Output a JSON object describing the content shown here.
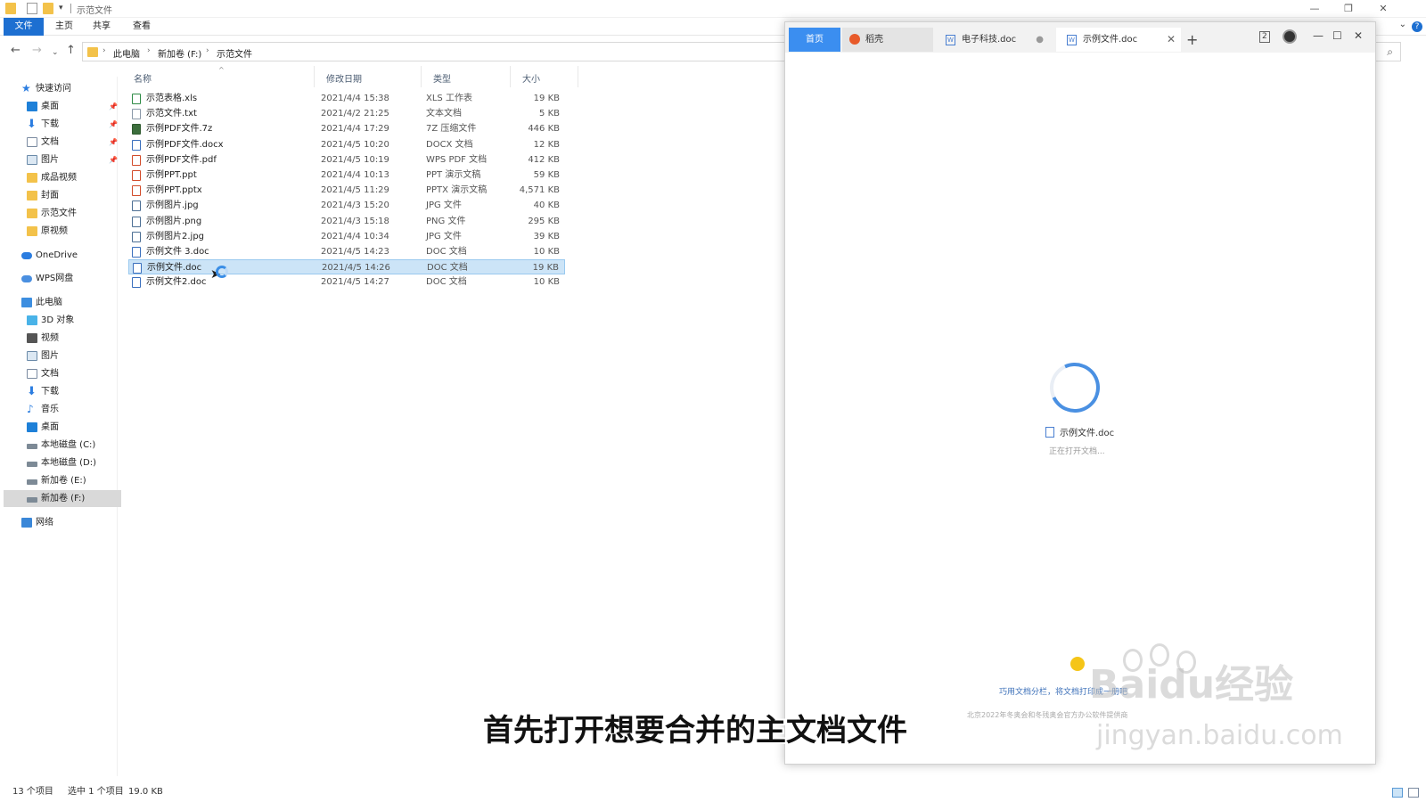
{
  "explorer": {
    "window_title": "示范文件",
    "ribbon_tabs": [
      "文件",
      "主页",
      "共享",
      "查看"
    ],
    "breadcrumb": [
      "此电脑",
      "新加卷 (F:)",
      "示范文件"
    ],
    "columns": {
      "name": "名称",
      "date": "修改日期",
      "type": "类型",
      "size": "大小"
    },
    "sidebar": {
      "quick_access": "快速访问",
      "items": [
        "桌面",
        "下载",
        "文档",
        "图片",
        "成品视频",
        "封面",
        "示范文件",
        "原视频"
      ],
      "onedrive": "OneDrive",
      "wps": "WPS网盘",
      "this_pc": "此电脑",
      "pc_items": [
        "3D 对象",
        "视频",
        "图片",
        "文档",
        "下载",
        "音乐",
        "桌面",
        "本地磁盘 (C:)",
        "本地磁盘 (D:)",
        "新加卷 (E:)",
        "新加卷 (F:)"
      ],
      "network": "网络"
    },
    "files": [
      {
        "name": "示范表格.xls",
        "date": "2021/4/4 15:38",
        "type": "XLS 工作表",
        "size": "19 KB",
        "icon": "xls"
      },
      {
        "name": "示范文件.txt",
        "date": "2021/4/2 21:25",
        "type": "文本文档",
        "size": "5 KB",
        "icon": "txt"
      },
      {
        "name": "示例PDF文件.7z",
        "date": "2021/4/4 17:29",
        "type": "7Z 压缩文件",
        "size": "446 KB",
        "icon": "z7"
      },
      {
        "name": "示例PDF文件.docx",
        "date": "2021/4/5 10:20",
        "type": "DOCX 文档",
        "size": "12 KB",
        "icon": "doc"
      },
      {
        "name": "示例PDF文件.pdf",
        "date": "2021/4/5 10:19",
        "type": "WPS PDF 文档",
        "size": "412 KB",
        "icon": "pdf"
      },
      {
        "name": "示例PPT.ppt",
        "date": "2021/4/4 10:13",
        "type": "PPT 演示文稿",
        "size": "59 KB",
        "icon": "ppt"
      },
      {
        "name": "示例PPT.pptx",
        "date": "2021/4/5 11:29",
        "type": "PPTX 演示文稿",
        "size": "4,571 KB",
        "icon": "ppt"
      },
      {
        "name": "示例图片.jpg",
        "date": "2021/4/3 15:20",
        "type": "JPG 文件",
        "size": "40 KB",
        "icon": "img"
      },
      {
        "name": "示例图片.png",
        "date": "2021/4/3 15:18",
        "type": "PNG 文件",
        "size": "295 KB",
        "icon": "img"
      },
      {
        "name": "示例图片2.jpg",
        "date": "2021/4/4 10:34",
        "type": "JPG 文件",
        "size": "39 KB",
        "icon": "img"
      },
      {
        "name": "示例文件 3.doc",
        "date": "2021/4/5 14:23",
        "type": "DOC 文档",
        "size": "10 KB",
        "icon": "doc"
      },
      {
        "name": "示例文件.doc",
        "date": "2021/4/5 14:26",
        "type": "DOC 文档",
        "size": "19 KB",
        "icon": "doc",
        "selected": true
      },
      {
        "name": "示例文件2.doc",
        "date": "2021/4/5 14:27",
        "type": "DOC 文档",
        "size": "10 KB",
        "icon": "doc"
      }
    ],
    "status": {
      "count": "13 个项目",
      "selected": "选中 1 个项目",
      "size": "19.0 KB"
    }
  },
  "wps": {
    "tabs": [
      "首页",
      "稻壳",
      "电子科技.doc",
      "示例文件.doc"
    ],
    "notification_count": "2",
    "loading_file": "示例文件.doc",
    "loading_text": "正在打开文档...",
    "tip": "巧用文档分栏，将文档打印成一册吧",
    "tip_sub": "北京2022年冬奥会和冬残奥会官方办公软件提供商"
  },
  "caption": "首先打开想要合并的主文档文件",
  "watermark": {
    "logo": "Baidu经验",
    "site": "jingyan.baidu.com"
  },
  "colors": {
    "accent": "#1d6fd1",
    "selection": "#cce4f7",
    "wps_blue": "#3b8ef0"
  },
  "icons": [
    "folder-icon",
    "back-icon",
    "forward-icon",
    "up-icon",
    "search-icon",
    "spinner-icon",
    "bulb-icon",
    "avatar"
  ]
}
